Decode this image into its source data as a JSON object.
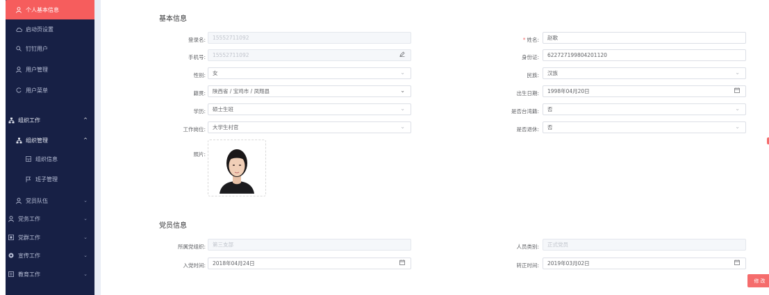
{
  "sidebar": {
    "items": [
      {
        "label": "个人基本信息",
        "icon": "user-icon"
      },
      {
        "label": "启动页设置",
        "icon": "cloud-icon"
      },
      {
        "label": "钉钉用户",
        "icon": "search-icon"
      },
      {
        "label": "用户管理",
        "icon": "user-icon"
      },
      {
        "label": "用户菜单",
        "icon": "refresh-icon"
      },
      {
        "label": "组织工作",
        "icon": "org-icon"
      },
      {
        "label": "组织管理",
        "icon": "org-icon"
      },
      {
        "label": "组织信息",
        "icon": "grid-icon"
      },
      {
        "label": "班子管理",
        "icon": "flag-icon"
      },
      {
        "label": "党员队伍",
        "icon": "user-icon"
      },
      {
        "label": "党务工作",
        "icon": "user-icon"
      },
      {
        "label": "党群工作",
        "icon": "square-icon"
      },
      {
        "label": "宣传工作",
        "icon": "globe-icon"
      },
      {
        "label": "教育工作",
        "icon": "book-icon"
      }
    ]
  },
  "basic": {
    "title": "基本信息",
    "login_label": "登录名:",
    "login_value": "15552711092",
    "phone_label": "手机号:",
    "phone_value": "15552711092",
    "gender_label": "性别:",
    "gender_value": "女",
    "native_label": "籍贯:",
    "native_value": "陕西省 / 宝鸡市 / 凤翔县",
    "education_label": "学历:",
    "education_value": "硕士生班",
    "job_label": "工作岗位:",
    "job_value": "大学生村官",
    "photo_label": "照片:",
    "name_label": "姓名:",
    "name_value": "赵歌",
    "id_label": "身份证:",
    "id_value": "622727199804201120",
    "nation_label": "民族:",
    "nation_value": "汉族",
    "birth_label": "出生日期:",
    "birth_value": "1998年04月20日",
    "taiwan_label": "是否台湾籍:",
    "taiwan_value": "否",
    "retired_label": "是否退休:",
    "retired_value": "否"
  },
  "party": {
    "title": "党员信息",
    "org_label": "所属党组织:",
    "org_value": "第三支部",
    "join_label": "入党时间:",
    "join_value": "2018年04月24日",
    "type_label": "人员类别:",
    "type_value": "正式党员",
    "regular_label": "转正时间:",
    "regular_value": "2019年03月02日"
  },
  "edit_button": "修 改",
  "colors": {
    "sidebar_bg": "#172045",
    "active": "#f65d5d",
    "button": "#f56c6c"
  }
}
